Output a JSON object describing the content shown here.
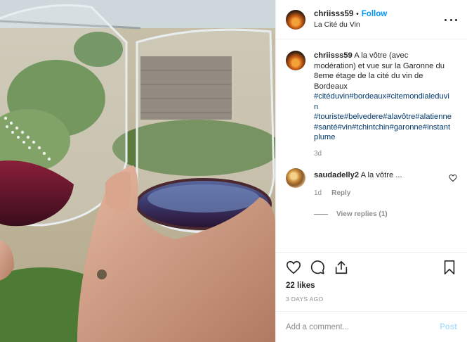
{
  "post": {
    "username": "chriisss59",
    "follow_label": "Follow",
    "location": "La Cité du Vin",
    "caption_text": "A la vôtre (avec modération) et vue sur la Garonne du 8eme étage de la cité du vin de Bordeaux",
    "caption_tags": "#citéduvin#bordeaux#citemondialeduvin #touriste#belvedere#alavôtre#alatienne#santé#vin#tchintchin#garonne#instantplume",
    "caption_age": "3d"
  },
  "comment": {
    "username": "saudadelly2",
    "text": "A la vôtre ...",
    "age": "1d",
    "reply_label": "Reply",
    "view_replies": "View replies (1)"
  },
  "stats": {
    "likes": "22 likes",
    "posted": "3 DAYS AGO"
  },
  "composer": {
    "placeholder": "Add a comment...",
    "post_label": "Post"
  },
  "icons": {
    "more": "more-options-icon",
    "like": "heart-icon",
    "comment": "comment-icon",
    "share": "share-icon",
    "save": "bookmark-icon",
    "comment_like": "heart-small-icon"
  }
}
